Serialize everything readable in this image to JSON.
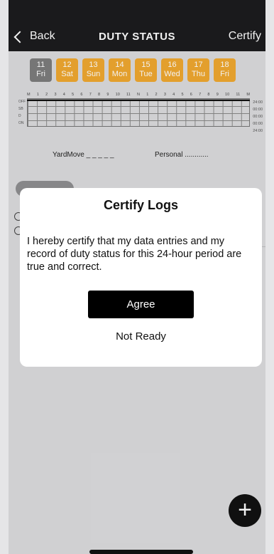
{
  "nav": {
    "back_label": "Back",
    "title": "DUTY STATUS",
    "certify_label": "Certify"
  },
  "days": [
    {
      "num": "11",
      "day": "Fri",
      "active": true
    },
    {
      "num": "12",
      "day": "Sat"
    },
    {
      "num": "13",
      "day": "Sun"
    },
    {
      "num": "14",
      "day": "Mon"
    },
    {
      "num": "15",
      "day": "Tue"
    },
    {
      "num": "16",
      "day": "Wed"
    },
    {
      "num": "17",
      "day": "Thu"
    },
    {
      "num": "18",
      "day": "Fri"
    }
  ],
  "grid": {
    "hours": [
      "M",
      "1",
      "2",
      "3",
      "4",
      "5",
      "6",
      "7",
      "8",
      "9",
      "10",
      "11",
      "N",
      "1",
      "2",
      "3",
      "4",
      "5",
      "6",
      "7",
      "8",
      "9",
      "10",
      "11",
      "M"
    ],
    "rows": [
      "OFF",
      "SB",
      "D",
      "ON"
    ],
    "times": [
      "24:00",
      "00:00",
      "00:00",
      "00:00",
      "24:00"
    ]
  },
  "legend": {
    "yardmove": "YardMove _ _ _ _ _",
    "personal": "Personal ............"
  },
  "modal": {
    "title": "Certify Logs",
    "message": "I hereby certify that my data entries and my record of duty status for this 24-hour period are true and correct.",
    "agree_label": "Agree",
    "not_ready_label": "Not Ready"
  },
  "fab": {
    "icon": "plus-icon",
    "glyph": "+"
  },
  "colors": {
    "accent": "#f0a830",
    "active_day": "#7d7d7d"
  }
}
